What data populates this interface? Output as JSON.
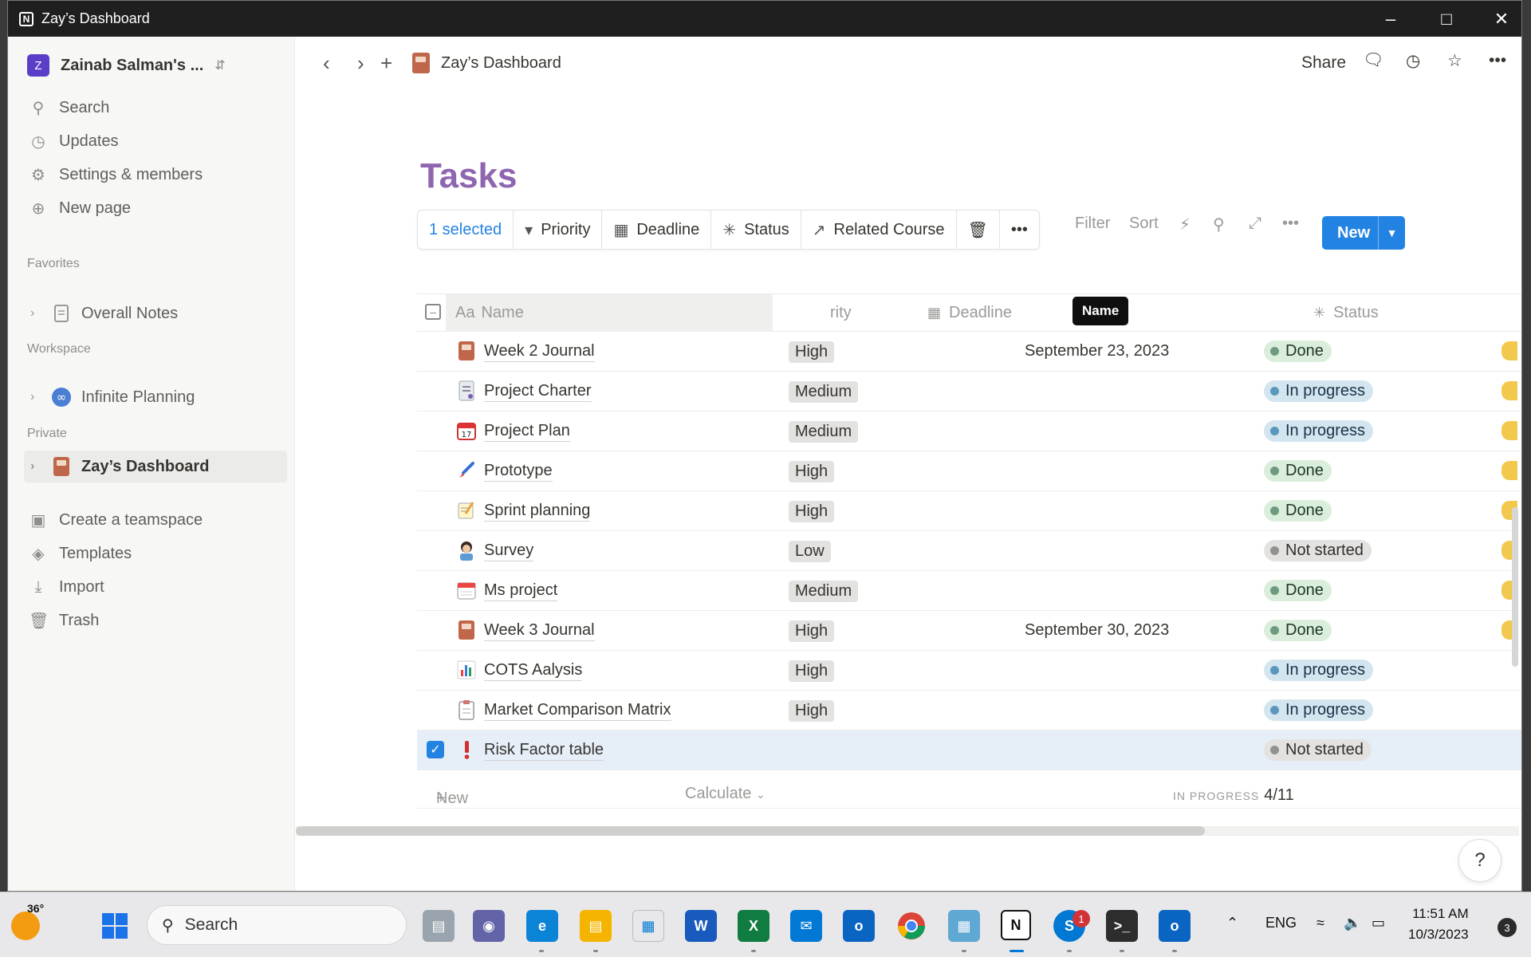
{
  "window": {
    "title": "Zay’s Dashboard"
  },
  "sidebar": {
    "workspace_name": "Zainab Salman's ...",
    "workspace_initial": "Z",
    "menu": [
      {
        "label": "Search",
        "icon": "search-icon"
      },
      {
        "label": "Updates",
        "icon": "clock-icon"
      },
      {
        "label": "Settings & members",
        "icon": "gear-icon"
      },
      {
        "label": "New page",
        "icon": "plus-circle-icon"
      }
    ],
    "favorites_heading": "Favorites",
    "favorites": [
      {
        "label": "Overall Notes"
      }
    ],
    "workspace_heading": "Workspace",
    "workspace_pages": [
      {
        "label": "Infinite Planning"
      }
    ],
    "private_heading": "Private",
    "private_pages": [
      {
        "label": "Zay’s Dashboard"
      }
    ],
    "bottom": [
      {
        "label": "Create a teamspace",
        "icon": "teamspace-icon"
      },
      {
        "label": "Templates",
        "icon": "templates-icon"
      },
      {
        "label": "Import",
        "icon": "download-icon"
      },
      {
        "label": "Trash",
        "icon": "trash-icon"
      }
    ]
  },
  "topbar": {
    "breadcrumb": "Zay’s Dashboard",
    "share": "Share"
  },
  "page": {
    "title": "Tasks"
  },
  "selection_bar": {
    "selected": "1 selected",
    "priority": "Priority",
    "deadline": "Deadline",
    "status": "Status",
    "related_course": "Related Course"
  },
  "view_tools": {
    "filter": "Filter",
    "sort": "Sort",
    "new": "New"
  },
  "table": {
    "columns": {
      "name": "Name",
      "priority": "rity",
      "deadline": "Deadline",
      "status": "Status",
      "name_prefix": "Aa"
    },
    "tooltip": "Name",
    "rows": [
      {
        "name": "Week 2 Journal",
        "icon": "journal-icon",
        "priority": "High",
        "deadline": "September 23, 2023",
        "status": "Done"
      },
      {
        "name": "Project Charter",
        "icon": "document-icon",
        "priority": "Medium",
        "deadline": "",
        "status": "In progress"
      },
      {
        "name": "Project Plan",
        "icon": "calendar-icon",
        "priority": "Medium",
        "deadline": "",
        "status": "In progress"
      },
      {
        "name": "Prototype",
        "icon": "paintbrush-icon",
        "priority": "High",
        "deadline": "",
        "status": "Done"
      },
      {
        "name": "Sprint planning",
        "icon": "memo-icon",
        "priority": "High",
        "deadline": "",
        "status": "Done"
      },
      {
        "name": "Survey",
        "icon": "person-icon",
        "priority": "Low",
        "deadline": "",
        "status": "Not started"
      },
      {
        "name": "Ms project",
        "icon": "spiral-calendar-icon",
        "priority": "Medium",
        "deadline": "",
        "status": "Done"
      },
      {
        "name": "Week 3 Journal",
        "icon": "journal-icon",
        "priority": "High",
        "deadline": "September 30, 2023",
        "status": "Done"
      },
      {
        "name": "COTS Aalysis",
        "icon": "bar-chart-icon",
        "priority": "High",
        "deadline": "",
        "status": "In progress"
      },
      {
        "name": "Market Comparison Matrix",
        "icon": "clipboard-icon",
        "priority": "High",
        "deadline": "",
        "status": "In progress"
      },
      {
        "name": "Risk Factor table",
        "icon": "exclamation-icon",
        "priority": "",
        "deadline": "",
        "status": "Not started",
        "selected": true
      }
    ],
    "add_new": "New",
    "calculate": "Calculate",
    "in_progress_label": "IN PROGRESS",
    "in_progress_count": "4/11"
  },
  "taskbar": {
    "weather": "36°",
    "search": "Search",
    "lang": "ENG",
    "time": "11:51 AM",
    "date": "10/3/2023",
    "skype_badge": "1",
    "notifications": "3"
  },
  "colors": {
    "accent": "#2383e2",
    "title": "#9065b0"
  }
}
